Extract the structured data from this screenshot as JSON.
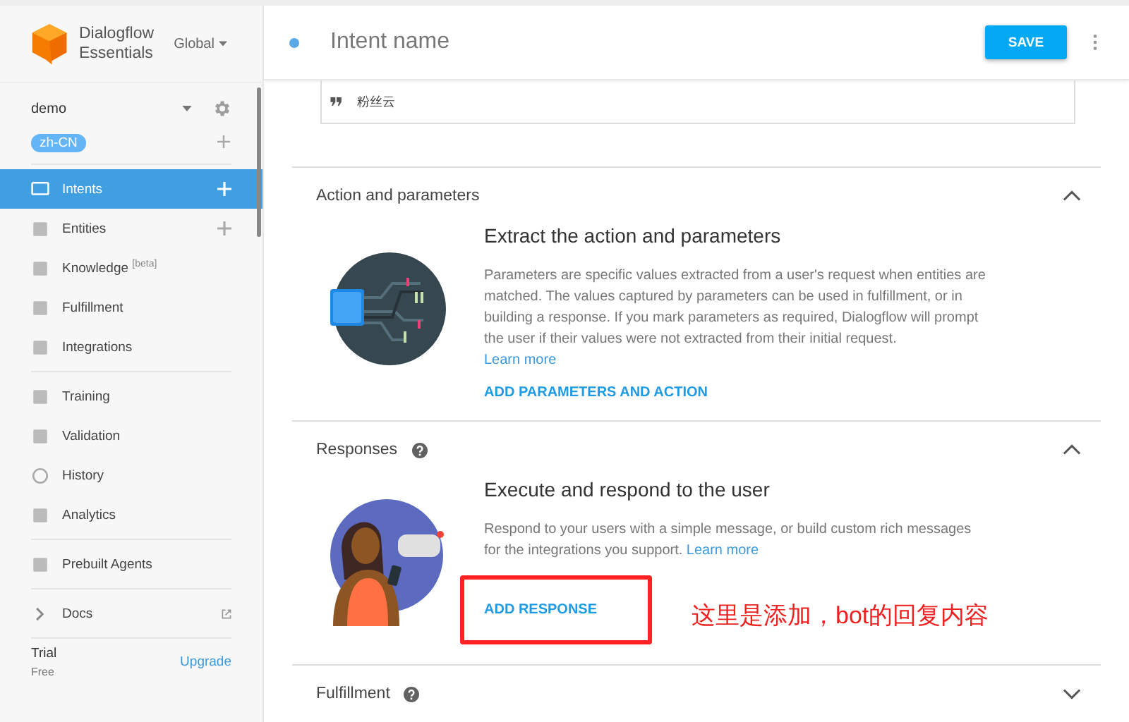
{
  "brand": {
    "line1": "Dialogflow",
    "line2": "Essentials",
    "region": "Global"
  },
  "agent": {
    "name": "demo",
    "language": "zh-CN"
  },
  "nav_groups": [
    [
      {
        "label": "Intents",
        "selected": true,
        "addable": true
      },
      {
        "label": "Entities",
        "selected": false,
        "addable": true
      },
      {
        "label": "Knowledge $^{[beta]}$",
        "selected": false,
        "addable": false
      },
      {
        "label": "Fulfillment",
        "selected": false,
        "addable": false
      },
      {
        "label": "Integrations",
        "selected": false,
        "addable": false
      }
    ],
    [
      {
        "label": "Training",
        "selected": false,
        "addable": false
      },
      {
        "label": "Validation",
        "selected": false,
        "addable": false
      },
      {
        "label": "History",
        "selected": false,
        "addable": false
      },
      {
        "label": "Analytics",
        "selected": false,
        "addable": false
      }
    ],
    [
      {
        "label": "Prebuilt Agents",
        "selected": false,
        "addable": false
      }
    ],
    [
      {
        "label": "Docs",
        "selected": false,
        "addable": false
      }
    ]
  ],
  "plan": {
    "name": "Trial",
    "tier": "Free",
    "upgrade": "Upgrade"
  },
  "header": {
    "placeholder": "Intent name",
    "save": "SAVE"
  },
  "training_phrase": "粉丝云",
  "sections": [
    {
      "title": "Action and parameters",
      "help": false,
      "expanded": true,
      "heading": "Extract the action and parameters",
      "text": "Parameters are specific values extracted from a user's request when entities are matched. The values captured by parameters can be used in fulfillment, or in building a response. If you mark parameters as required, Dialogflow will prompt the user if their values were not extracted from their initial request.",
      "link": "Learn more",
      "link_inline": false,
      "action": "ADD PARAMETERS AND ACTION",
      "annotated": false
    },
    {
      "title": "Responses",
      "help": true,
      "expanded": true,
      "heading": "Execute and respond to the user",
      "text": "Respond to your users with a simple message, or build custom rich messages for the integrations you support.",
      "link": "Learn more",
      "link_inline": true,
      "action": "ADD RESPONSE",
      "annotated": true
    },
    {
      "title": "Fulfillment",
      "help": true,
      "expanded": false
    }
  ],
  "annotation": "这里是添加，bot的回复内容"
}
